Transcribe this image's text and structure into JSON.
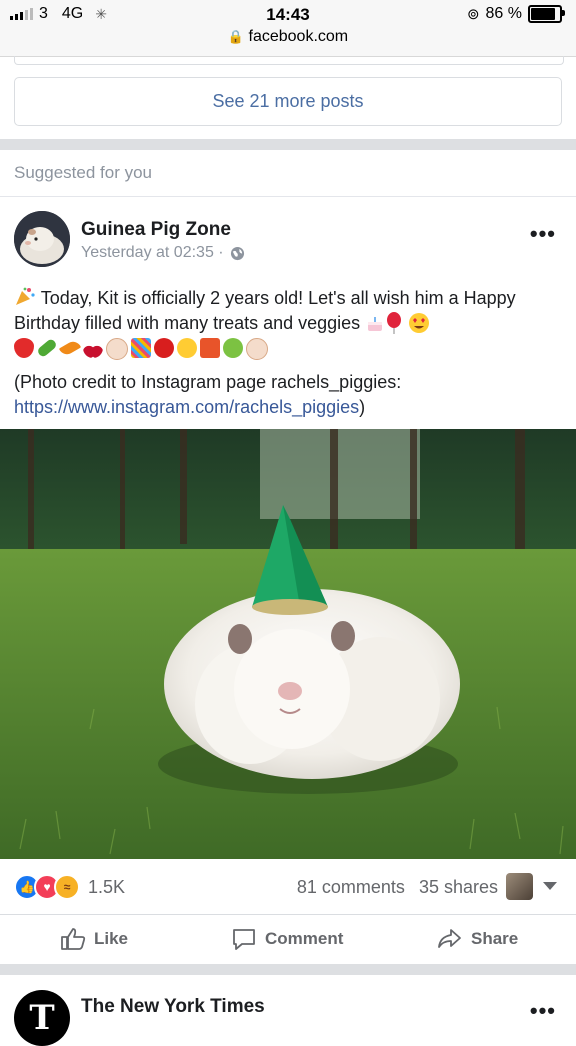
{
  "status_bar": {
    "carrier": "3",
    "network": "4G",
    "time": "14:43",
    "url": "facebook.com",
    "battery": "86 %",
    "battery_level": 0.86
  },
  "feed": {
    "see_more_label": "See 21 more posts",
    "suggested_label": "Suggested for you"
  },
  "post": {
    "page_name": "Guinea Pig Zone",
    "timestamp": "Yesterday at 02:35 ·",
    "text_line1": "Today, Kit is officially 2 years old! Let's all wish him a Happy Birthday filled with many treats and veggies",
    "credit_text": "(Photo credit to Instagram page rachels_piggies:",
    "credit_link": "https://www.instagram.com/rachels_piggies",
    "credit_close": ")",
    "reaction_count": "1.5K",
    "comments": "81 comments",
    "shares": "35 shares",
    "actions": {
      "like": "Like",
      "comment": "Comment",
      "share": "Share"
    },
    "more_icon": "more-horizontal-icon",
    "accent_color": "#385898"
  },
  "next_post": {
    "page_name": "The New York Times",
    "avatar_letter": "T"
  }
}
